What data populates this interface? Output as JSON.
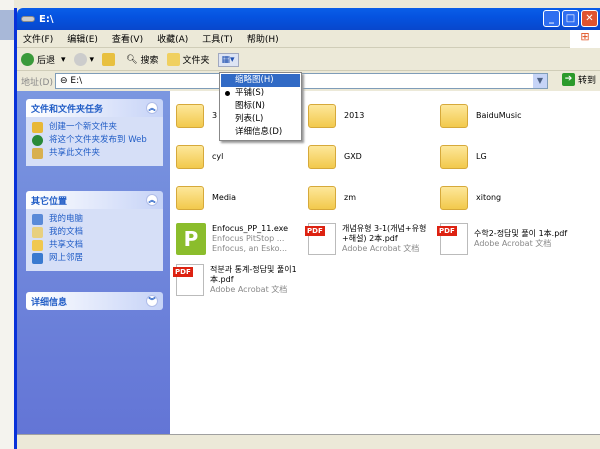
{
  "window": {
    "title": "E:\\"
  },
  "menu": [
    "文件(F)",
    "编辑(E)",
    "查看(V)",
    "收藏(A)",
    "工具(T)",
    "帮助(H)"
  ],
  "toolbar": {
    "back": "后退",
    "search": "搜索",
    "folders": "文件夹"
  },
  "address": {
    "label": "地址(D)",
    "value": "E:\\",
    "go": "转到"
  },
  "view_menu": {
    "items": [
      "缩略图(H)",
      "平铺(S)",
      "图标(N)",
      "列表(L)",
      "详细信息(D)"
    ],
    "highlighted": 0,
    "checked": 1
  },
  "panels": [
    {
      "title": "文件和文件夹任务",
      "items": [
        "创建一个新文件夹",
        "将这个文件夹发布到 Web",
        "共享此文件夹"
      ]
    },
    {
      "title": "其它位置",
      "items": [
        "我的电脑",
        "我的文档",
        "共享文档",
        "网上邻居"
      ]
    },
    {
      "title": "详细信息",
      "items": []
    }
  ],
  "files": [
    {
      "name": "3",
      "type": "folder"
    },
    {
      "name": "2013",
      "type": "folder"
    },
    {
      "name": "BaiduMusic",
      "type": "folder"
    },
    {
      "name": "cyl",
      "type": "folder"
    },
    {
      "name": "GXD",
      "type": "folder"
    },
    {
      "name": "LG",
      "type": "folder"
    },
    {
      "name": "Media",
      "type": "folder"
    },
    {
      "name": "zm",
      "type": "folder"
    },
    {
      "name": "xitong",
      "type": "folder"
    },
    {
      "name": "Enfocus_PP_11.exe",
      "type": "exe",
      "sub1": "Enfocus PitStop ...",
      "sub2": "Enfocus, an Esko..."
    },
    {
      "name": "개념유형 3-1(개념+유형+해설) 2本.pdf",
      "type": "pdf",
      "sub1": "Adobe Acrobat 文档"
    },
    {
      "name": "수학2-정답및 풀이 1本.pdf",
      "type": "pdf",
      "sub1": "Adobe Acrobat 文档"
    },
    {
      "name": "적분과 통계-정답및 풀이1本.pdf",
      "type": "pdf",
      "sub1": "Adobe Acrobat 文档"
    }
  ]
}
